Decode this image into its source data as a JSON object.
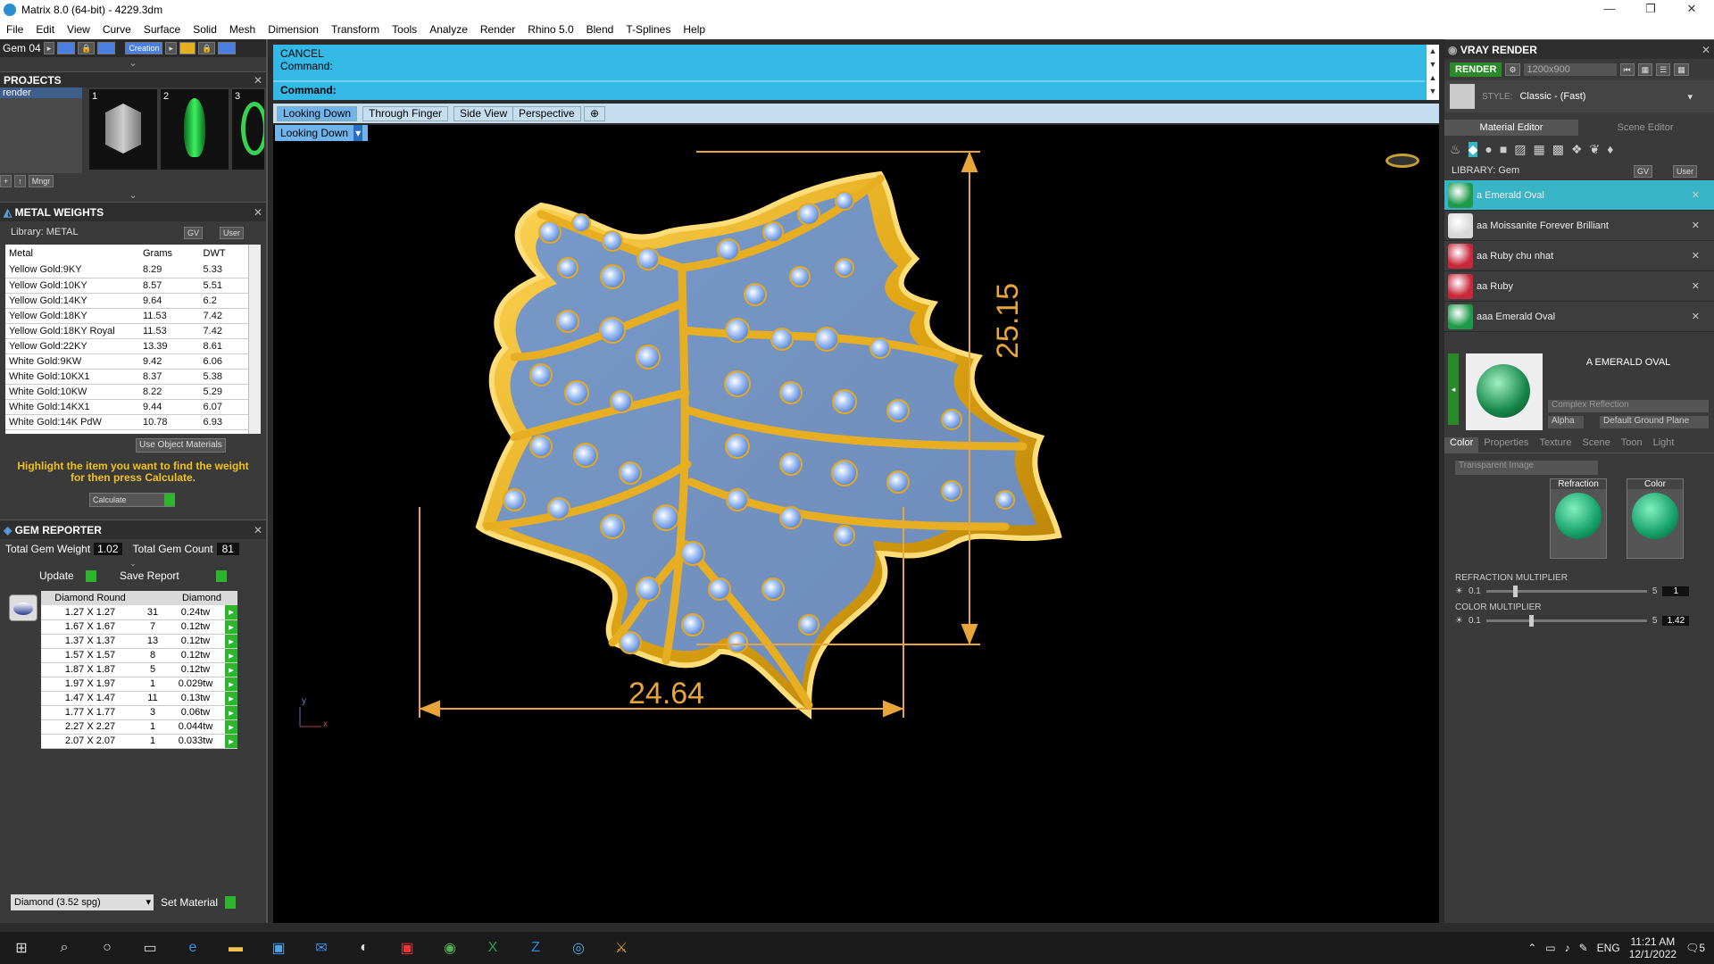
{
  "window": {
    "title": "Matrix 8.0 (64-bit) - 4229.3dm"
  },
  "menu": [
    "File",
    "Edit",
    "View",
    "Curve",
    "Surface",
    "Solid",
    "Mesh",
    "Dimension",
    "Transform",
    "Tools",
    "Analyze",
    "Render",
    "Rhino 5.0",
    "Blend",
    "T-Splines",
    "Help"
  ],
  "toolbar": {
    "gem_label": "Gem 04",
    "creation_label": "Creation"
  },
  "projects": {
    "title": "PROJECTS",
    "item": "render",
    "thumb_nums": [
      "1",
      "2",
      "3"
    ],
    "mgr_label": "Mngr"
  },
  "metal_weights": {
    "title": "METAL WEIGHTS",
    "library": "Library: METAL",
    "gv": "GV",
    "user": "User",
    "headers": [
      "Metal",
      "Grams",
      "DWT"
    ],
    "rows": [
      [
        "Yellow Gold:9KY",
        "8.29",
        "5.33"
      ],
      [
        "Yellow Gold:10KY",
        "8.57",
        "5.51"
      ],
      [
        "Yellow Gold:14KY",
        "9.64",
        "6.2"
      ],
      [
        "Yellow Gold:18KY",
        "11.53",
        "7.42"
      ],
      [
        "Yellow Gold:18KY Royal",
        "11.53",
        "7.42"
      ],
      [
        "Yellow Gold:22KY",
        "13.39",
        "8.61"
      ],
      [
        "White Gold:9KW",
        "9.42",
        "6.06"
      ],
      [
        "White Gold:10KX1",
        "8.37",
        "5.38"
      ],
      [
        "White Gold:10KW",
        "8.22",
        "5.29"
      ],
      [
        "White Gold:14KX1",
        "9.44",
        "6.07"
      ],
      [
        "White Gold:14K PdW",
        "10.78",
        "6.93"
      ]
    ],
    "use_object": "Use Object Materials",
    "hint": "Highlight the item you want to find the weight for then press Calculate.",
    "calculate": "Calculate"
  },
  "gem_reporter": {
    "title": "GEM REPORTER",
    "total_weight_label": "Total Gem Weight",
    "total_weight": "1.02",
    "total_count_label": "Total Gem Count",
    "total_count": "81",
    "update": "Update",
    "save": "Save Report",
    "headers": [
      "Diamond Round",
      "",
      "Diamond"
    ],
    "rows": [
      [
        "1.27 X 1.27",
        "31",
        "0.24tw"
      ],
      [
        "1.67 X 1.67",
        "7",
        "0.12tw"
      ],
      [
        "1.37 X 1.37",
        "13",
        "0.12tw"
      ],
      [
        "1.57 X 1.57",
        "8",
        "0.12tw"
      ],
      [
        "1.87 X 1.87",
        "5",
        "0.12tw"
      ],
      [
        "1.97 X 1.97",
        "1",
        "0.029tw"
      ],
      [
        "1.47 X 1.47",
        "11",
        "0.13tw"
      ],
      [
        "1.77 X 1.77",
        "3",
        "0.06tw"
      ],
      [
        "2.27 X 2.27",
        "1",
        "0.044tw"
      ],
      [
        "2.07 X 2.07",
        "1",
        "0.033tw"
      ]
    ],
    "material_select": "Diamond   (3.52 spg)",
    "set_material": "Set Material"
  },
  "command": {
    "line1": "CANCEL",
    "line2": "Command:",
    "line3": "Command:"
  },
  "views": {
    "tabs": [
      "Looking Down",
      "Through Finger",
      "Side View",
      "Perspective"
    ],
    "current": "Looking Down"
  },
  "dimensions": {
    "height": "25.15",
    "width": "24.64"
  },
  "axis": {
    "y": "y",
    "x": "x"
  },
  "vray": {
    "title": "VRAY RENDER",
    "render": "RENDER",
    "resolution": "1200x900",
    "style_label": "STYLE:",
    "style_value": "Classic - (Fast)",
    "tabs": [
      "Material Editor",
      "Scene Editor"
    ],
    "library": "LIBRARY: Gem",
    "gv": "GV",
    "user": "User",
    "materials": [
      {
        "name": "a Emerald Oval",
        "color": "#1f9a4a"
      },
      {
        "name": "aa Moissanite Forever Brilliant",
        "color": "#d8d8d8"
      },
      {
        "name": "aa Ruby chu nhat",
        "color": "#c8283a"
      },
      {
        "name": "aa Ruby",
        "color": "#c8283a"
      },
      {
        "name": "aaa Emerald Oval",
        "color": "#1f9a4a"
      }
    ],
    "selected_name": "A EMERALD OVAL",
    "reflection": "Complex Reflection",
    "alpha": "Alpha",
    "ground": "Default Ground Plane",
    "prop_tabs": [
      "Color",
      "Properties",
      "Texture",
      "Scene",
      "Toon",
      "Light"
    ],
    "image_mode": "Transparent Image",
    "refraction_label": "Refraction",
    "color_label": "Color",
    "refraction_multiplier": {
      "label": "REFRACTION MULTIPLIER",
      "min": "0.1",
      "max": "5",
      "value": "1"
    },
    "color_multiplier": {
      "label": "COLOR MULTIPLIER",
      "min": "0.1",
      "max": "5",
      "value": "1.42"
    }
  },
  "taskbar": {
    "lang": "ENG",
    "time": "11:21 AM",
    "date": "12/1/2022",
    "notif": "5"
  }
}
